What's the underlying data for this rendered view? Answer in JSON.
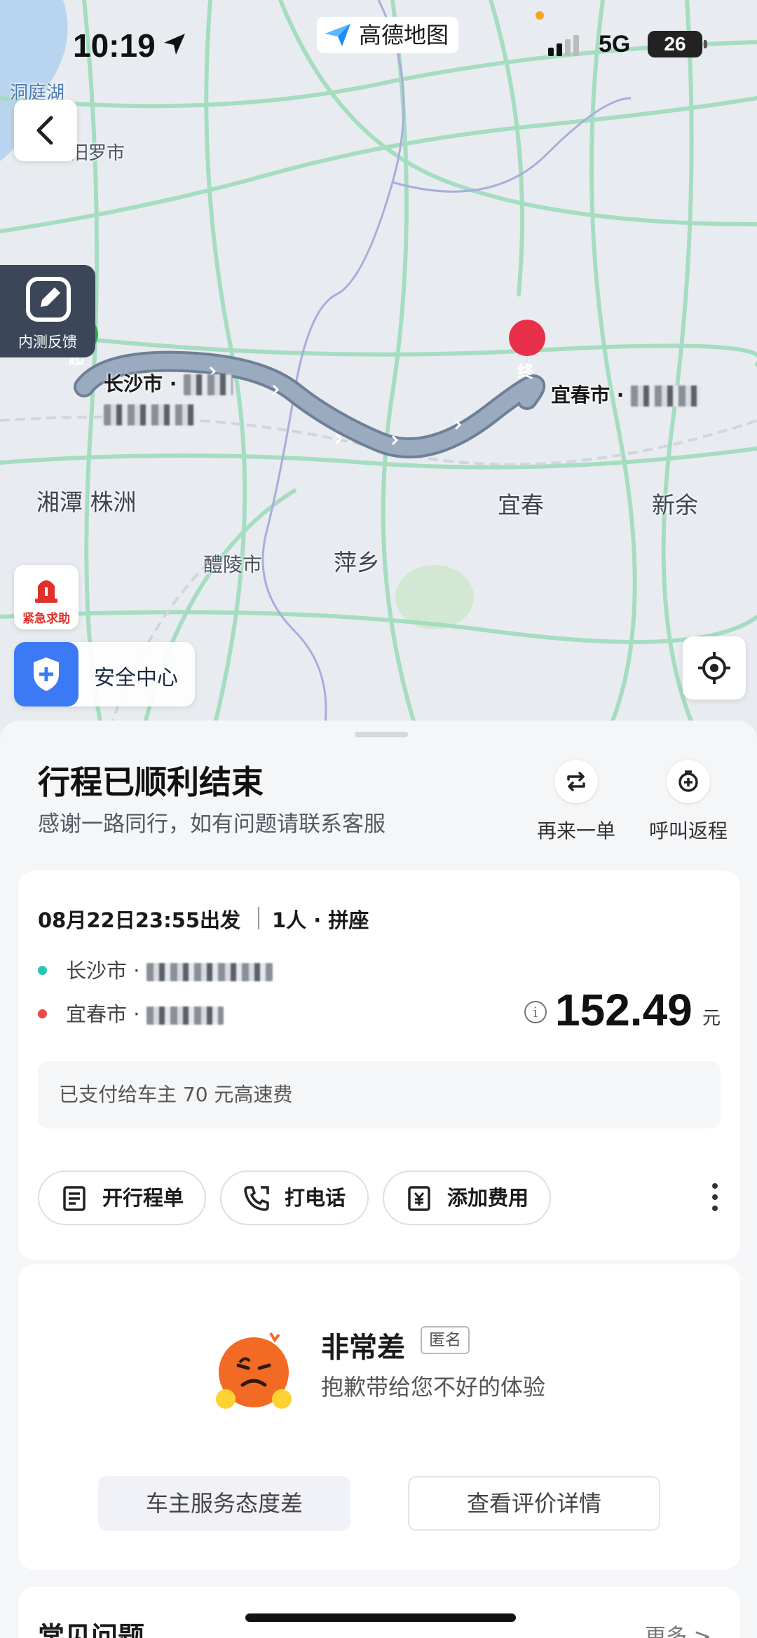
{
  "status_bar": {
    "time": "10:19",
    "network": "5G",
    "battery": "26"
  },
  "app_badge": {
    "name": "高德地图"
  },
  "map": {
    "labels": {
      "dongting": "洞庭湖",
      "miluo": "汨罗市",
      "xiangtan_zhuzhou": "湘潭 株洲",
      "liling": "醴陵市",
      "pingxiang": "萍乡",
      "yichun": "宜春",
      "xinyu": "新余"
    },
    "start_marker": "起",
    "end_marker": "终",
    "start_label": "长沙市 · ",
    "end_label": "宜春市 · "
  },
  "buttons": {
    "feedback": "内测反馈",
    "sos": "紧急求助",
    "safety": "安全中心"
  },
  "trip": {
    "title": "行程已顺利结束",
    "subtitle": "感谢一路同行，如有问题请联系客服",
    "again_label": "再来一单",
    "return_label": "呼叫返程",
    "depart_time": "08月22日23:55出发",
    "passengers": "1人 · 拼座",
    "origin": "长沙市 · ",
    "destination": "宜春市 · ",
    "price": "152.49",
    "price_unit": "元",
    "toll_note": "已支付给车主 70 元高速费",
    "invoice_label": "开行程单",
    "call_label": "打电话",
    "add_fee_label": "添加费用"
  },
  "rating": {
    "title": "非常差",
    "anon_tag": "匿名",
    "subtitle": "抱歉带给您不好的体验",
    "tag_label": "车主服务态度差",
    "detail_label": "查看评价详情"
  },
  "faq": {
    "title": "常见问题",
    "more": "更多 >"
  },
  "colors": {
    "accent": "#3c7af5",
    "route": "#8a9aaf",
    "origin_dot": "#22c7b8",
    "dest_dot": "#e84a4a"
  }
}
